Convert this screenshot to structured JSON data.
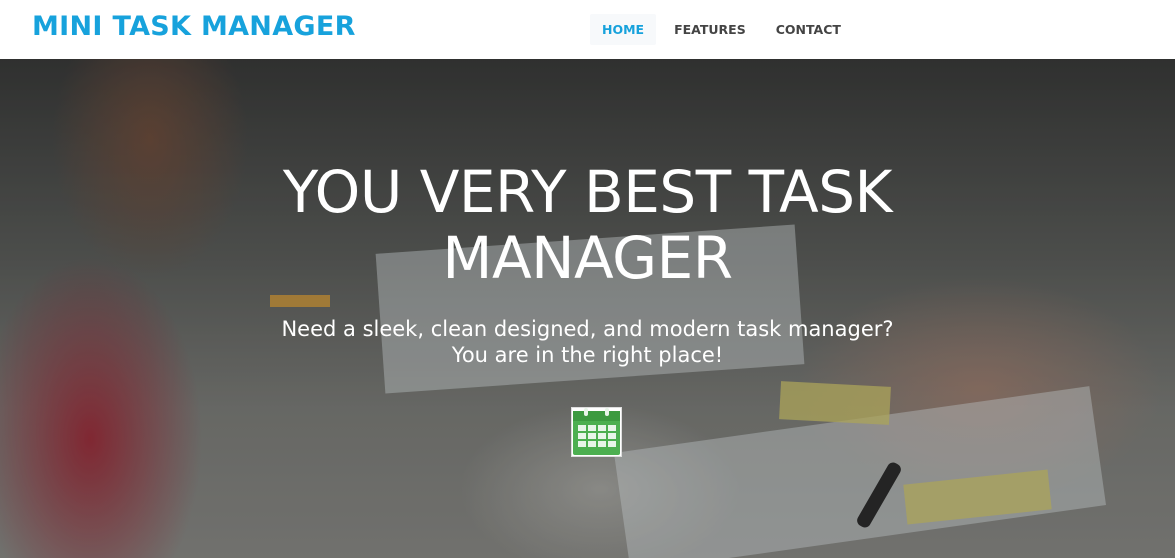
{
  "navbar": {
    "brand": "MINI TASK MANAGER",
    "links": [
      {
        "label": "HOME"
      },
      {
        "label": "FEATURES"
      },
      {
        "label": "CONTACT"
      }
    ]
  },
  "hero": {
    "title_line1": "YOU VERY BEST TASK",
    "title_line2": "MANAGER",
    "subtitle_line1": "Need a sleek, clean designed, and modern task manager?",
    "subtitle_line2": "You are in the right place!",
    "cta_icon": "calendar-icon"
  },
  "colors": {
    "brand": "#17a2dc",
    "nav_text": "#444444",
    "hero_text": "#ffffff",
    "icon_green": "#4caf50"
  }
}
